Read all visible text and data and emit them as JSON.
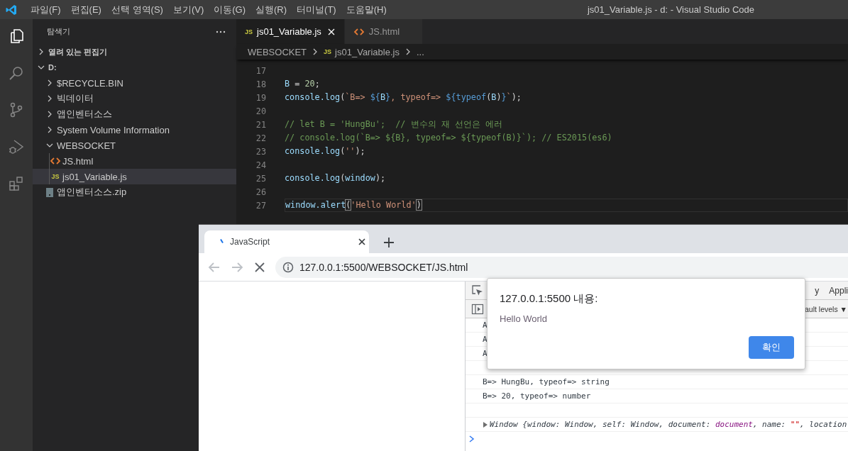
{
  "window": {
    "title": "js01_Variable.js - d: - Visual Studio Code"
  },
  "menu": [
    "파일(F)",
    "편집(E)",
    "선택 영역(S)",
    "보기(V)",
    "이동(G)",
    "실행(R)",
    "터미널(T)",
    "도움말(H)"
  ],
  "activity_bar": [
    {
      "kind": "files",
      "selected": true
    },
    {
      "kind": "search",
      "selected": false
    },
    {
      "kind": "source-control",
      "selected": false
    },
    {
      "kind": "debug",
      "selected": false
    },
    {
      "kind": "extensions",
      "selected": false
    }
  ],
  "sidebar": {
    "title": "탐색기",
    "sections": [
      {
        "label": "열려 있는 편집기",
        "expanded": false
      },
      {
        "label": "D:",
        "expanded": true,
        "children": [
          {
            "label": "$RECYCLE.BIN",
            "kind": "folder",
            "expanded": false,
            "selected": false
          },
          {
            "label": "빅데이터",
            "kind": "folder",
            "expanded": false,
            "selected": false
          },
          {
            "label": "앱인벤터소스",
            "kind": "folder",
            "expanded": false,
            "selected": false
          },
          {
            "label": "System Volume Information",
            "kind": "folder",
            "expanded": false,
            "selected": false
          },
          {
            "label": "WEBSOCKET",
            "kind": "folder",
            "expanded": true,
            "selected": false,
            "children": [
              {
                "label": "JS.html",
                "kind": "html",
                "selected": false
              },
              {
                "label": "js01_Variable.js",
                "kind": "js",
                "icon_text": "JS",
                "selected": true
              }
            ]
          },
          {
            "label": "앱인벤터소스.zip",
            "kind": "zip",
            "selected": false
          }
        ]
      }
    ]
  },
  "editor": {
    "tabs": [
      {
        "label": "js01_Variable.js",
        "kind": "js",
        "icon_text": "JS",
        "selected": true
      },
      {
        "label": "JS.html",
        "kind": "html",
        "selected": false
      }
    ],
    "breadcrumb": [
      {
        "label": "WEBSOCKET"
      },
      {
        "label": "js01_Variable.js",
        "icon_text": "JS"
      },
      {
        "label": "..."
      }
    ],
    "lines": [
      {
        "number": "17"
      },
      {
        "number": "18",
        "current": false,
        "tokens": [
          {
            "text": "B",
            "kind": "var"
          },
          {
            "text": " = ",
            "kind": "plain"
          },
          {
            "text": "20",
            "kind": "num"
          },
          {
            "text": ";",
            "kind": "plain"
          }
        ]
      },
      {
        "number": "19",
        "current": false,
        "tokens": [
          {
            "text": "console.log",
            "kind": "var"
          },
          {
            "text": "(",
            "kind": "plain"
          },
          {
            "text": "`B=> ",
            "kind": "str"
          },
          {
            "text": "${",
            "kind": "kw"
          },
          {
            "text": "B",
            "kind": "var"
          },
          {
            "text": "}",
            "kind": "kw"
          },
          {
            "text": ", typeof=> ",
            "kind": "str"
          },
          {
            "text": "${typeof",
            "kind": "kw"
          },
          {
            "text": "(",
            "kind": "plain"
          },
          {
            "text": "B",
            "kind": "var"
          },
          {
            "text": ")",
            "kind": "plain"
          },
          {
            "text": "}",
            "kind": "kw"
          },
          {
            "text": "`",
            "kind": "str"
          },
          {
            "text": ");",
            "kind": "plain"
          }
        ]
      },
      {
        "number": "20"
      },
      {
        "number": "21",
        "current": false,
        "tokens": [
          {
            "text": "// let B = 'HungBu';  // 변수의 재 선언은 에러",
            "kind": "cmt"
          }
        ]
      },
      {
        "number": "22",
        "current": false,
        "tokens": [
          {
            "text": "// console.log(`B=> ${B}, typeof=> ${typeof(B)}`); // ES2015(es6)",
            "kind": "cmt"
          }
        ]
      },
      {
        "number": "23",
        "current": false,
        "tokens": [
          {
            "text": "console.log",
            "kind": "var"
          },
          {
            "text": "(",
            "kind": "plain"
          },
          {
            "text": "''",
            "kind": "str"
          },
          {
            "text": ");",
            "kind": "plain"
          }
        ]
      },
      {
        "number": "24"
      },
      {
        "number": "25",
        "current": false,
        "tokens": [
          {
            "text": "console.log",
            "kind": "var"
          },
          {
            "text": "(",
            "kind": "plain"
          },
          {
            "text": "window",
            "kind": "var"
          },
          {
            "text": ");",
            "kind": "plain"
          }
        ]
      },
      {
        "number": "26"
      },
      {
        "number": "27",
        "current": true,
        "tokens": [
          {
            "text": "window.alert",
            "kind": "var"
          },
          {
            "text": "(",
            "kind": "bracket"
          },
          {
            "text": "'Hello World'",
            "kind": "str"
          },
          {
            "text": ")",
            "kind": "bracket"
          }
        ]
      }
    ]
  },
  "browser": {
    "tab": {
      "title": "JavaScript",
      "loading": true
    },
    "nav": [
      {
        "kind": "back",
        "disabled": true
      },
      {
        "kind": "forward",
        "disabled": true
      },
      {
        "kind": "stop",
        "disabled": false
      }
    ],
    "url": "127.0.0.1:5500/WEBSOCKET/JS.html",
    "devtools": {
      "panel_tabs": [
        "y",
        "Appli"
      ],
      "filter": "ault levels ▼",
      "console": [
        {
          "kind": "log",
          "text": "A"
        },
        {
          "kind": "log",
          "text": "A"
        },
        {
          "kind": "log",
          "text": "A"
        },
        {
          "kind": "blank"
        },
        {
          "kind": "log",
          "text": "B=> HungBu, typeof=> string"
        },
        {
          "kind": "log",
          "text": "B=> 20, typeof=> number"
        },
        {
          "kind": "blank"
        },
        {
          "kind": "object",
          "tokens": [
            {
              "text": "Window {window: Window, self: Window, document: ",
              "kind": "plain"
            },
            {
              "text": "document",
              "kind": "ref"
            },
            {
              "text": ", name: ",
              "kind": "plain"
            },
            {
              "text": "\"\"",
              "kind": "str"
            },
            {
              "text": ", location",
              "kind": "plain"
            }
          ]
        },
        {
          "kind": "prompt"
        }
      ]
    }
  },
  "dialog": {
    "title": "127.0.0.1:5500 내용:",
    "message": "Hello World",
    "button": "확인"
  }
}
